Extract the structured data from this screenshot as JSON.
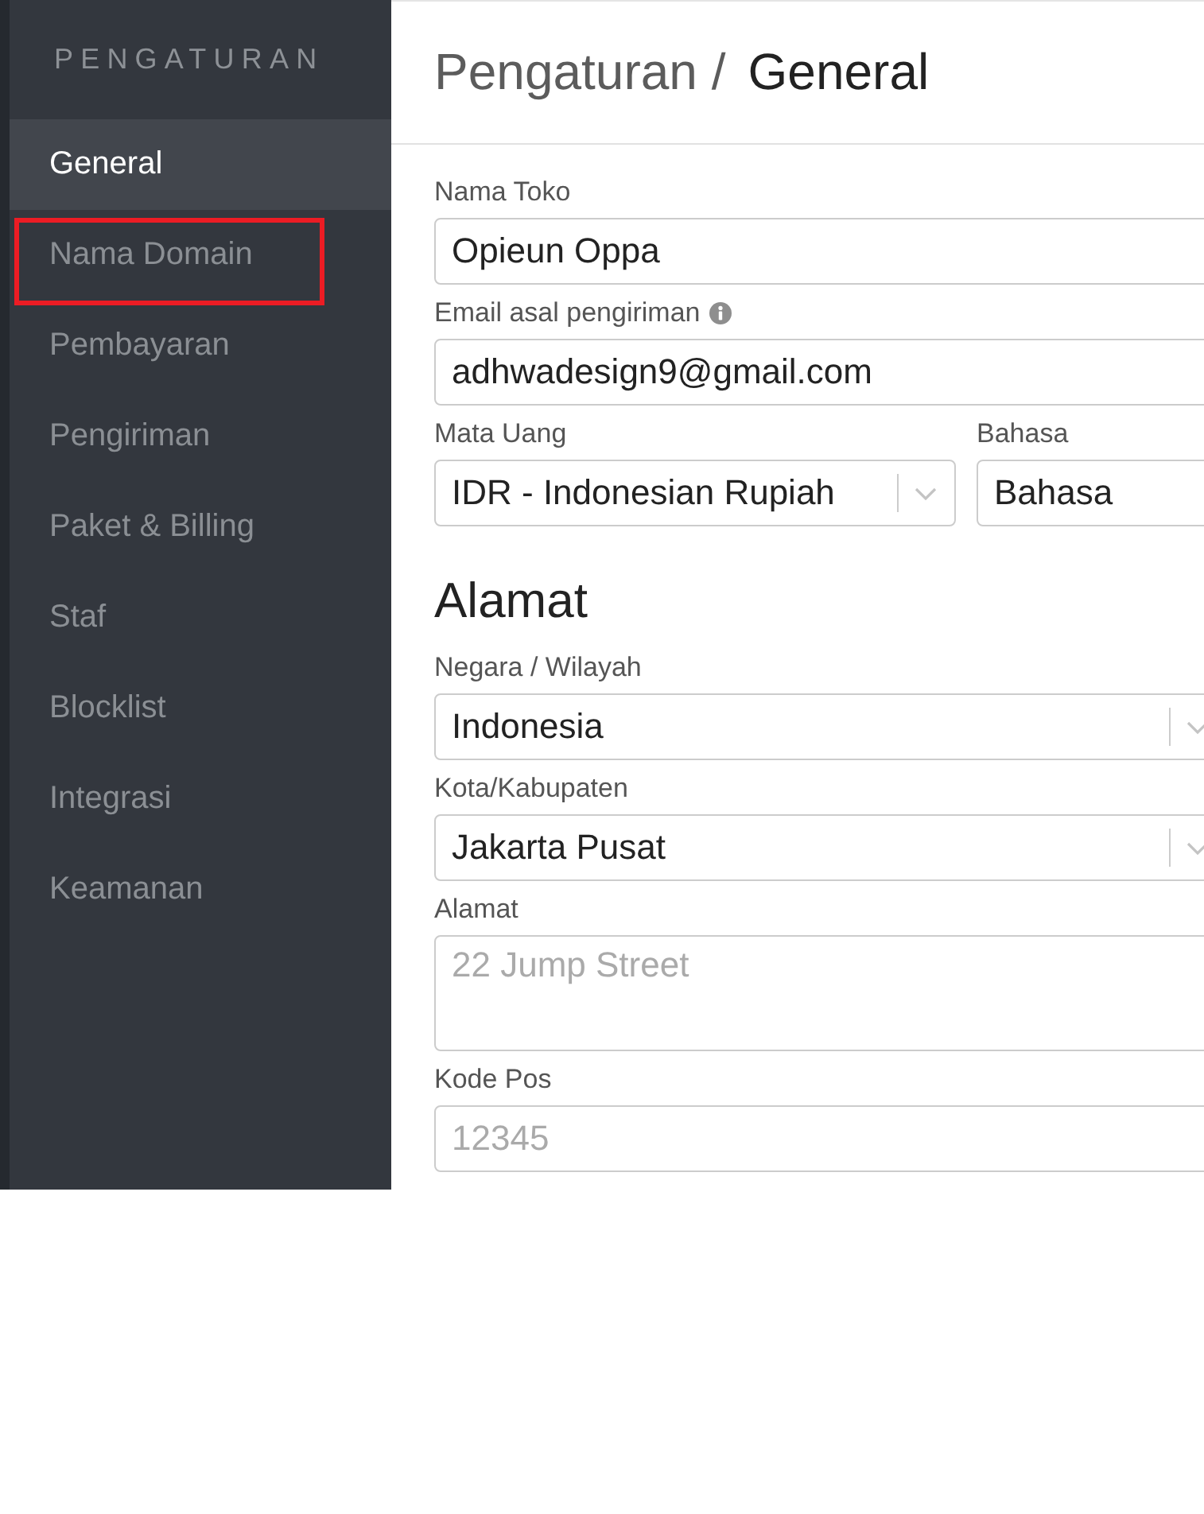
{
  "sidebar": {
    "title": "PENGATURAN",
    "items": [
      {
        "label": "General",
        "selected": true,
        "highlighted": false
      },
      {
        "label": "Nama Domain",
        "selected": false,
        "highlighted": true
      },
      {
        "label": "Pembayaran",
        "selected": false,
        "highlighted": false
      },
      {
        "label": "Pengiriman",
        "selected": false,
        "highlighted": false
      },
      {
        "label": "Paket & Billing",
        "selected": false,
        "highlighted": false
      },
      {
        "label": "Staf",
        "selected": false,
        "highlighted": false
      },
      {
        "label": "Blocklist",
        "selected": false,
        "highlighted": false
      },
      {
        "label": "Integrasi",
        "selected": false,
        "highlighted": false
      },
      {
        "label": "Keamanan",
        "selected": false,
        "highlighted": false
      }
    ]
  },
  "header": {
    "breadcrumb": "Pengaturan /",
    "title": "General"
  },
  "store_fields": [
    [
      {
        "label": "Nama Toko",
        "kind": "text",
        "value": "Opieun Oppa",
        "info": false
      }
    ],
    [
      {
        "label": "Email asal pengiriman",
        "kind": "text",
        "value": "adhwadesign9@gmail.com",
        "info": true
      }
    ],
    [
      {
        "label": "Mata Uang",
        "kind": "select",
        "value": "IDR - Indonesian Rupiah",
        "info": false
      },
      {
        "label": "Bahasa",
        "kind": "text",
        "value": "Bahasa",
        "info": false
      }
    ]
  ],
  "address": {
    "heading": "Alamat",
    "fields": [
      [
        {
          "label": "Negara / Wilayah",
          "kind": "select",
          "value": "Indonesia",
          "info": false
        }
      ],
      [
        {
          "label": "Kota/Kabupaten",
          "kind": "select",
          "value": "Jakarta Pusat",
          "info": false
        }
      ],
      [
        {
          "label": "Alamat",
          "kind": "textarea",
          "placeholder": "22 Jump Street",
          "info": false
        }
      ],
      [
        {
          "label": "Kode Pos",
          "kind": "text",
          "placeholder": "12345",
          "info": false
        }
      ]
    ]
  }
}
